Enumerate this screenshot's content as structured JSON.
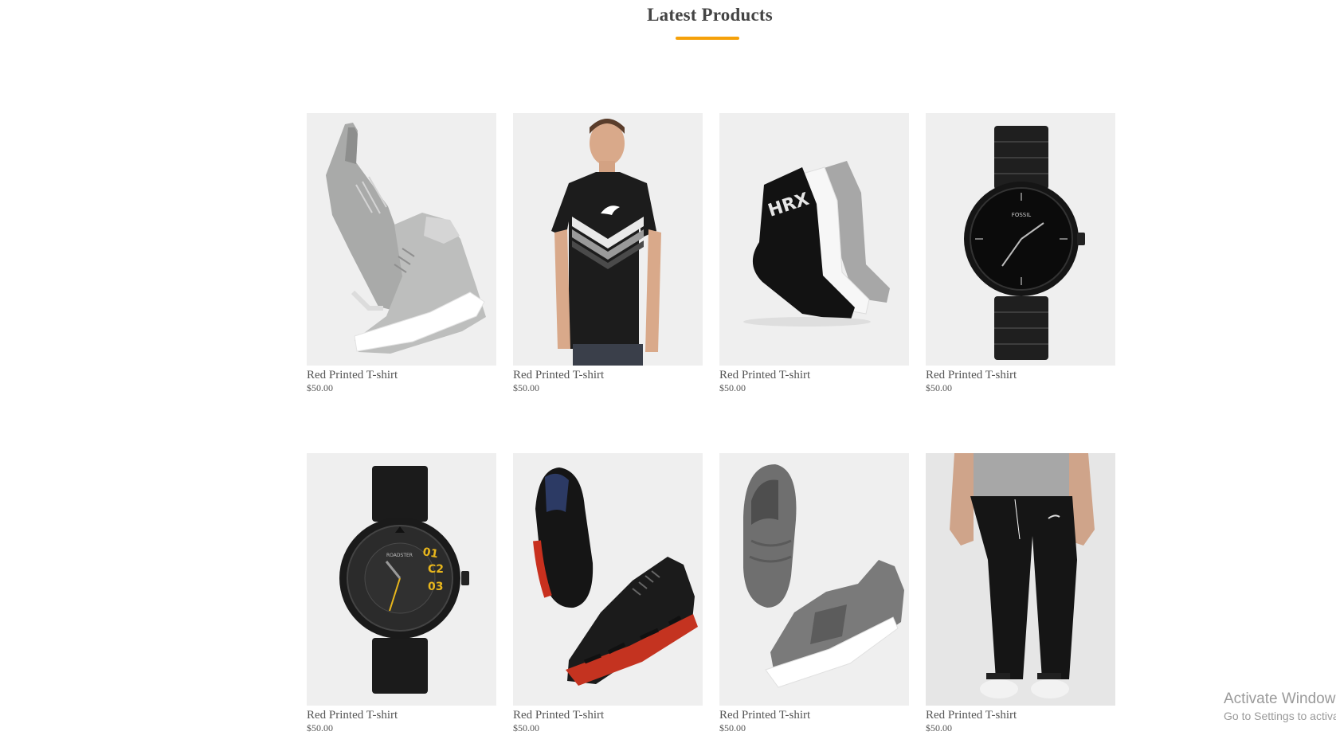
{
  "section": {
    "title": "Latest Products",
    "accent_color": "#f5a10a"
  },
  "products": [
    {
      "name": "Red Printed T-shirt",
      "price": "$50.00",
      "image": "high-top-sneakers-grey"
    },
    {
      "name": "Red Printed T-shirt",
      "price": "$50.00",
      "image": "black-puma-tshirt-model"
    },
    {
      "name": "Red Printed T-shirt",
      "price": "$50.00",
      "image": "ankle-socks-three-pack"
    },
    {
      "name": "Red Printed T-shirt",
      "price": "$50.00",
      "image": "black-fossil-watch"
    },
    {
      "name": "Red Printed T-shirt",
      "price": "$50.00",
      "image": "black-leather-strap-watch"
    },
    {
      "name": "Red Printed T-shirt",
      "price": "$50.00",
      "image": "black-red-running-shoes"
    },
    {
      "name": "Red Printed T-shirt",
      "price": "$50.00",
      "image": "grey-slip-on-sneakers"
    },
    {
      "name": "Red Printed T-shirt",
      "price": "$50.00",
      "image": "black-jogger-pants-model"
    }
  ],
  "images": {
    "fossil_brand": "FOSSIL",
    "roadster_brand": "ROADSTER",
    "hrx_brand": "HRX"
  },
  "watermark": {
    "line1": "Activate Windows",
    "line2": "Go to Settings to activate Windows."
  }
}
